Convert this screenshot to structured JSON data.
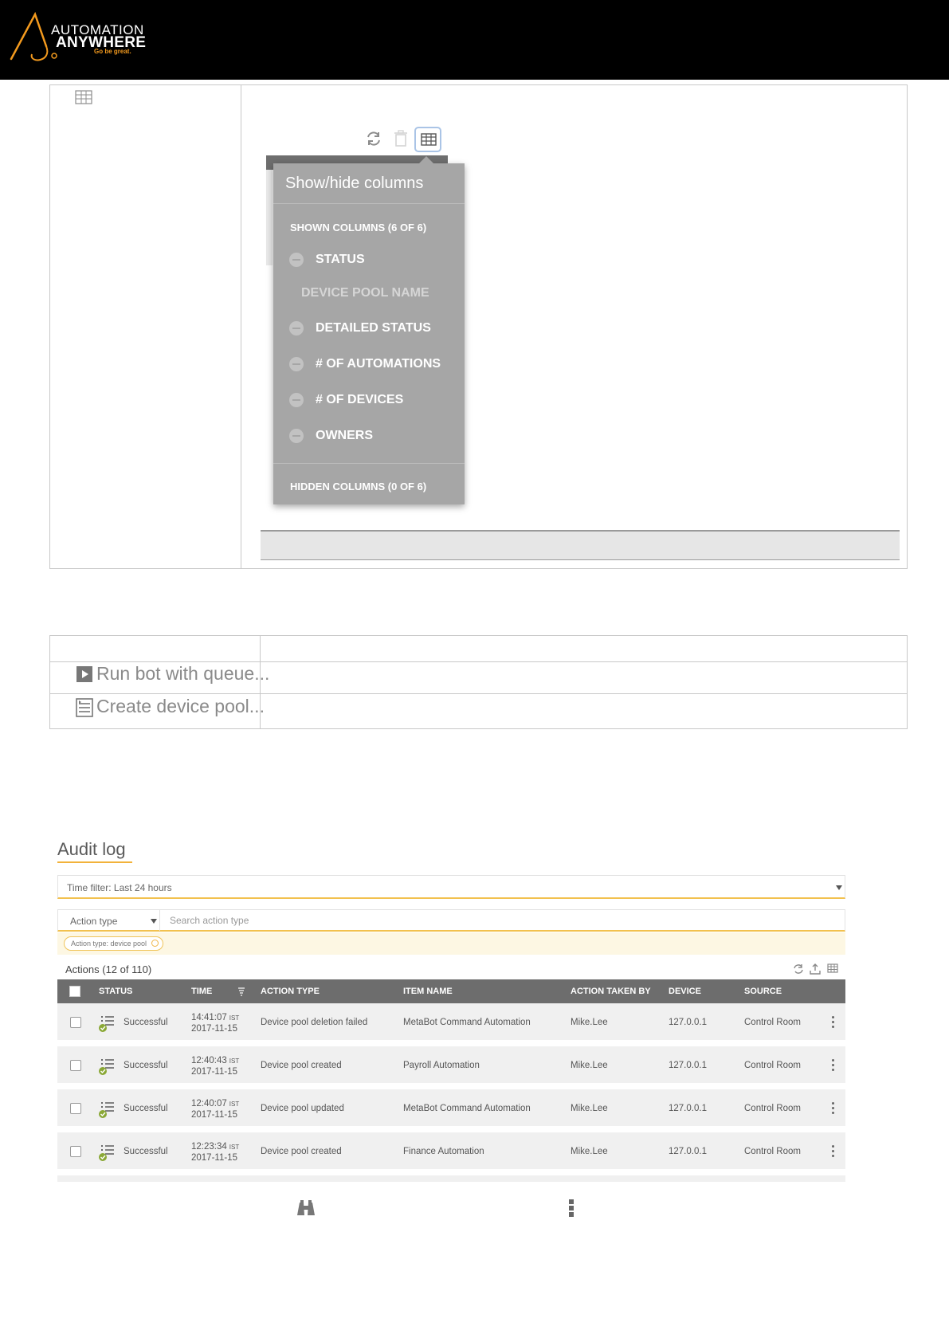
{
  "header": {
    "logo_line1": "AUTOMATION",
    "logo_line2": "ANYWHERE",
    "logo_tagline": "Go be great.",
    "brand_color": "#f39a1e"
  },
  "popover": {
    "title": "Show/hide columns",
    "shown_section": "SHOWN COLUMNS (6 OF 6)",
    "items": [
      {
        "label": "STATUS",
        "removable": true
      },
      {
        "label": "DEVICE POOL NAME",
        "removable": false
      },
      {
        "label": "DETAILED STATUS",
        "removable": true
      },
      {
        "label": "# OF AUTOMATIONS",
        "removable": true
      },
      {
        "label": "# OF DEVICES",
        "removable": true
      },
      {
        "label": "OWNERS",
        "removable": true
      }
    ],
    "hidden_section": "HIDDEN COLUMNS (0 OF 6)"
  },
  "table2": {
    "rows": [
      {
        "label": "Run bot with queue...",
        "icon": "play-icon"
      },
      {
        "label": "Create device pool...",
        "icon": "device-pool-icon"
      }
    ]
  },
  "audit": {
    "title": "Audit log",
    "time_filter": "Time filter: Last 24 hours",
    "action_type_label": "Action type",
    "search_placeholder": "Search action type",
    "chip_label": "Action type: device pool",
    "actions_title": "Actions (12 of 110)",
    "columns": [
      "STATUS",
      "TIME",
      "ACTION TYPE",
      "ITEM NAME",
      "ACTION TAKEN BY",
      "DEVICE",
      "SOURCE"
    ],
    "rows": [
      {
        "status": "Successful",
        "time": "14:41:07",
        "tz": "IST",
        "date": "2017-11-15",
        "action": "Device pool deletion failed",
        "item": "MetaBot Command Automation",
        "by": "Mike.Lee",
        "device": "127.0.0.1",
        "source": "Control Room"
      },
      {
        "status": "Successful",
        "time": "12:40:43",
        "tz": "IST",
        "date": "2017-11-15",
        "action": "Device pool created",
        "item": "Payroll Automation",
        "by": "Mike.Lee",
        "device": "127.0.0.1",
        "source": "Control Room"
      },
      {
        "status": "Successful",
        "time": "12:40:07",
        "tz": "IST",
        "date": "2017-11-15",
        "action": "Device pool updated",
        "item": "MetaBot Command Automation",
        "by": "Mike.Lee",
        "device": "127.0.0.1",
        "source": "Control Room"
      },
      {
        "status": "Successful",
        "time": "12:23:34",
        "tz": "IST",
        "date": "2017-11-15",
        "action": "Device pool created",
        "item": "Finance Automation",
        "by": "Mike.Lee",
        "device": "127.0.0.1",
        "source": "Control Room"
      }
    ],
    "accent_color": "#f2b23a"
  }
}
